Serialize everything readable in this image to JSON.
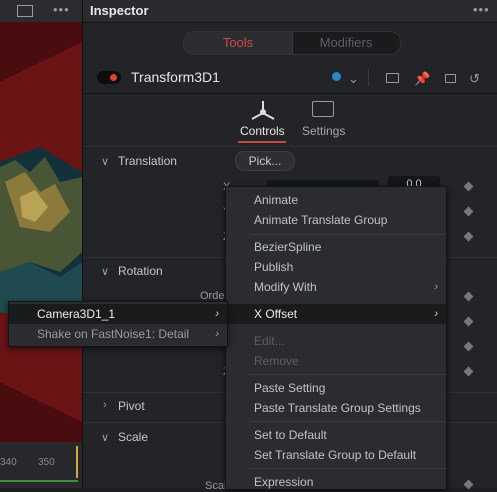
{
  "inspector": {
    "title": "Inspector",
    "tabs": [
      "Tools",
      "Modifiers"
    ],
    "node_name": "Transform3D1",
    "subtabs": [
      "Controls",
      "Settings"
    ],
    "sections": {
      "translation": "Translation",
      "rotation": "Rotation",
      "pivot": "Pivot",
      "scale": "Scale"
    },
    "pick_label": "Pick...",
    "partial_labels": {
      "x": "X",
      "y": "Y",
      "z": "Z",
      "order": "Orde",
      "z2": "Z",
      "scale": "Scale"
    },
    "value_partial": "0.0"
  },
  "viewer": {
    "ruler": [
      "340",
      "350"
    ]
  },
  "context_menu": {
    "items": [
      {
        "label": "Animate",
        "state": "normal"
      },
      {
        "label": "Animate Translate Group",
        "state": "normal"
      },
      {
        "label": "BezierSpline",
        "state": "normal"
      },
      {
        "label": "Publish",
        "state": "normal"
      },
      {
        "label": "Modify With",
        "state": "normal",
        "submenu": true
      },
      {
        "label": "X Offset",
        "state": "highlight",
        "submenu": true
      },
      {
        "label": "Edit...",
        "state": "disabled"
      },
      {
        "label": "Remove",
        "state": "disabled"
      },
      {
        "label": "Paste Setting",
        "state": "normal"
      },
      {
        "label": "Paste Translate Group Settings",
        "state": "normal"
      },
      {
        "label": "Set to Default",
        "state": "normal"
      },
      {
        "label": "Set Translate Group to Default",
        "state": "normal"
      },
      {
        "label": "Expression",
        "state": "normal"
      }
    ]
  },
  "submenu": {
    "items": [
      {
        "label": "Camera3D1_1",
        "state": "highlight"
      },
      {
        "label": "Shake on FastNoise1: Detail",
        "state": "dim"
      }
    ]
  },
  "colors": {
    "accent": "#c84a44",
    "toggle_on": "#e0403a",
    "node_dot": "#2a86c9"
  }
}
